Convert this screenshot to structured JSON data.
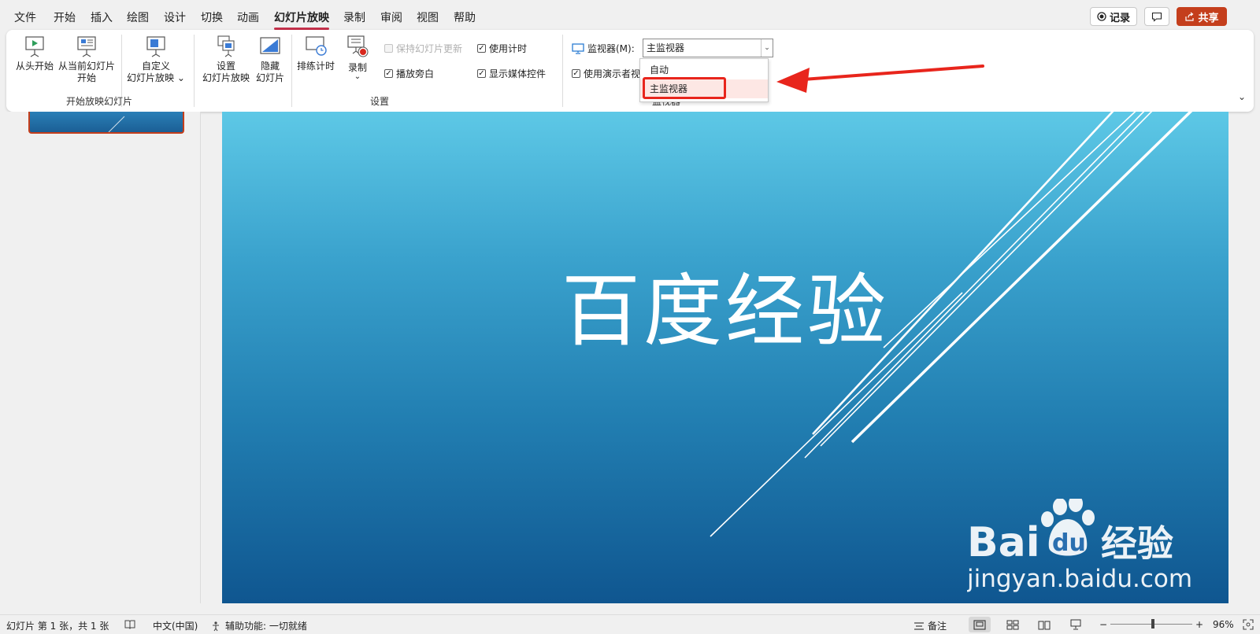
{
  "menu": {
    "tabs": [
      "文件",
      "开始",
      "插入",
      "绘图",
      "设计",
      "切换",
      "动画",
      "幻灯片放映",
      "录制",
      "审阅",
      "视图",
      "帮助"
    ],
    "active_tab": "幻灯片放映",
    "record_button": "记录",
    "share_button": "共享"
  },
  "ribbon": {
    "start_group": {
      "from_beginning": "从头开始",
      "from_current_line1": "从当前幻灯片",
      "from_current_line2": "开始",
      "custom_line1": "自定义",
      "custom_line2": "幻灯片放映",
      "label": "开始放映幻灯片"
    },
    "setup_group": {
      "setup_line1": "设置",
      "setup_line2": "幻灯片放映",
      "hide_line1": "隐藏",
      "hide_line2": "幻灯片",
      "rehearse": "排练计时",
      "record": "录制",
      "keep_updated": "保持幻灯片更新",
      "keep_updated_checked": false,
      "play_narration": "播放旁白",
      "play_narration_checked": true,
      "use_timings": "使用计时",
      "use_timings_checked": true,
      "show_media_controls": "显示媒体控件",
      "show_media_controls_checked": true,
      "label": "设置"
    },
    "monitor_group": {
      "monitor_label": "监视器(M):",
      "selected_monitor": "主监视器",
      "presenter_view": "使用演示者视",
      "presenter_view_checked": true,
      "label": "监视器",
      "options": [
        "自动",
        "主监视器"
      ],
      "highlighted_option": "主监视器"
    }
  },
  "slide": {
    "title": "百度经验"
  },
  "watermark": {
    "logo_text": "Bai  经验",
    "url": "jingyan.baidu.com"
  },
  "status": {
    "slide_info": "幻灯片 第 1 张，共 1 张",
    "language": "中文(中国)",
    "accessibility": "辅助功能: 一切就绪",
    "notes": "备注",
    "zoom": "96%",
    "zoom_fraction": 0.52
  },
  "colors": {
    "accent": "#c43e1c",
    "highlight_red": "#e8251c",
    "slide_top": "#5dc8e6",
    "slide_bottom": "#0f5690"
  }
}
